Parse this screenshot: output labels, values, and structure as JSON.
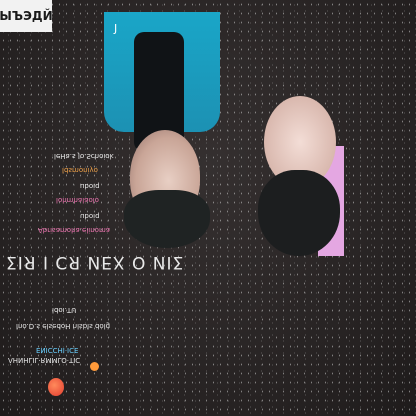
{
  "brand": {
    "text": "ЫЪЭДЙ"
  },
  "shirt_logo": {
    "text": "J"
  },
  "captions": {
    "line1": "leHa.s Jo.Schoiok",
    "line2": "ldsmoniyo",
    "line3": "uboiq",
    "line4": "lohmhalaolo",
    "line5": "uboiq",
    "line6": "Abrisamoha.elinoma",
    "headline": "ΣIЯ I CЯ ИEX O ИIΣ",
    "sub1": "ldoi.TU",
    "sub2": "lno.D.s elsedoH nlsbls dolg",
    "sub3": "ENICCHI·ICE",
    "sub4": "ΛHNHLIL·RMMLO·TIC"
  },
  "colors": {
    "background": "#2a2626",
    "shirt": "#1aa6c8",
    "pink_text": "#ef77b3",
    "orange_text": "#f0a24a"
  }
}
